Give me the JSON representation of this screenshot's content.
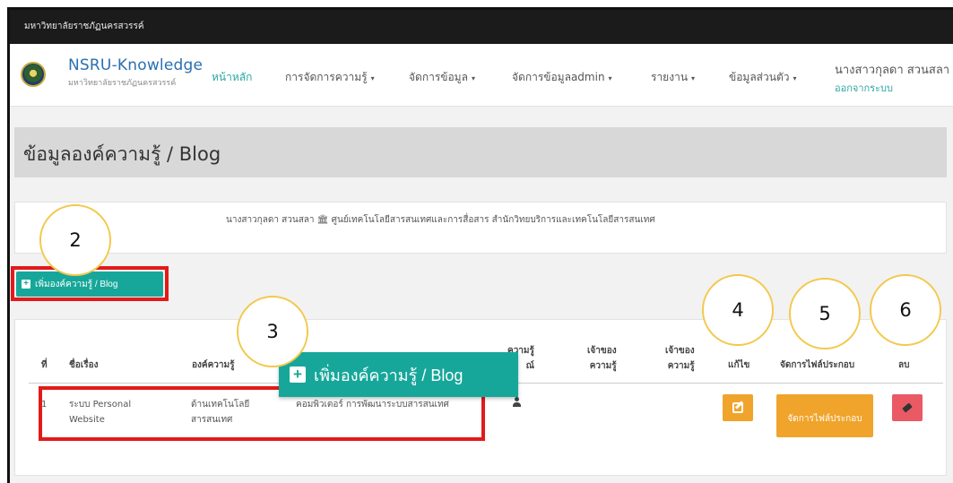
{
  "topbar": {
    "text": "มหาวิทยาลัยราชภัฏนครสวรรค์"
  },
  "brand": {
    "name": "NSRU-Knowledge",
    "subtitle": "มหาวิทยาลัยราชภัฏนครสวรรค์"
  },
  "nav": {
    "items": [
      {
        "label": "หน้าหลัก",
        "caret": ""
      },
      {
        "label": "การจัดการความรู้",
        "caret": "▾"
      },
      {
        "label": "จัดการข้อมูล",
        "caret": "▾"
      },
      {
        "label": "จัดการข้อมูลadmin",
        "caret": "▾"
      },
      {
        "label": "รายงาน",
        "caret": "▾"
      },
      {
        "label": "ข้อมูลส่วนตัว",
        "caret": "▾"
      }
    ],
    "user_name": "นางสาวกุลดา สวนสลา",
    "logout": "ออกจากระบบ"
  },
  "page": {
    "title": "ข้อมูลองค์ความรู้ / Blog"
  },
  "info": {
    "text": "นางสาวกุลดา สวนสลา 🏛 ศูนย์เทคโนโลยีสารสนเทศและการสื่อสาร สำนักวิทยบริการและเทคโนโลยีสารสนเทศ"
  },
  "add_button": {
    "label": "เพิ่มองค์ความรู้ / Blog"
  },
  "table": {
    "headers": {
      "no": "ที่",
      "title": "ชื่อเรื่อง",
      "knowledge": "องค์ความรู้",
      "share_1": "ความรู้",
      "share_2": "ณ์",
      "owner_a_1": "เจ้าของ",
      "owner_a_2": "ความรู้",
      "owner_b_1": "เจ้าของ",
      "owner_b_2": "ความรู้",
      "edit": "แก้ไข",
      "files": "จัดการไฟล์ประกอบ",
      "delete": "ลบ"
    },
    "row": {
      "no": "1",
      "title": "ระบบ Personal Website",
      "knowledge": "ด้านเทคโนโลยีสารสนเทศ",
      "category": "คอมพิวเตอร์ การพัฒนาระบบสารสนเทศ",
      "files_button": "จัดการไฟล์ประกอบ"
    }
  },
  "zoom_button": {
    "label": "เพิ่มองค์ความรู้ / Blog"
  },
  "callouts": [
    "2",
    "3",
    "4",
    "5",
    "6"
  ],
  "colors": {
    "teal": "#17a79a",
    "orange": "#f0a42b",
    "red_button": "#ea5a64",
    "highlight_red": "#e31a1a",
    "callout_yellow": "#f2c94c"
  }
}
